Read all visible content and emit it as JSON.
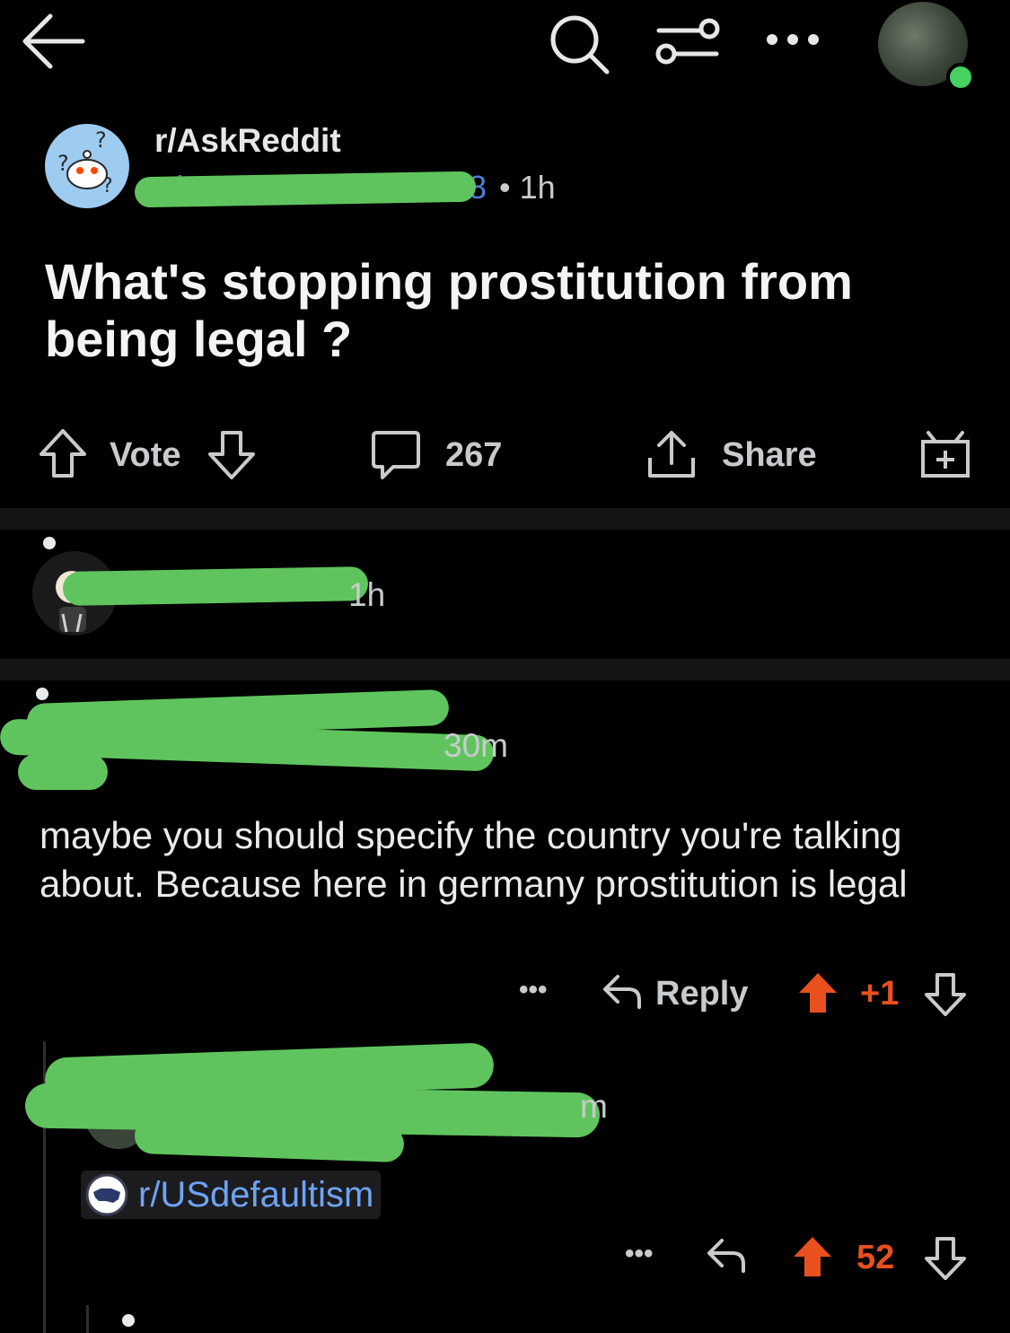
{
  "post": {
    "subreddit": "r/AskReddit",
    "author_partial": "u/",
    "author_tail": "8",
    "time": "• 1h",
    "title": "What's stopping prostitution from being legal ?",
    "vote_label": "Vote",
    "comment_count": "267",
    "share_label": "Share"
  },
  "comments": [
    {
      "time": "1h"
    },
    {
      "time": "30m",
      "body": "maybe you should specify the country you're talking about. Because here in germany prostitution is legal",
      "more": "•••",
      "reply_label": "Reply",
      "score": "+1"
    },
    {
      "time": "m",
      "flair": "r/USdefaultism",
      "more": "•••",
      "score": "52"
    }
  ],
  "colors": {
    "accent_red": "#e8501e",
    "link_blue": "#4f7fd8",
    "online": "#46d160",
    "redaction": "#5fc45e"
  }
}
